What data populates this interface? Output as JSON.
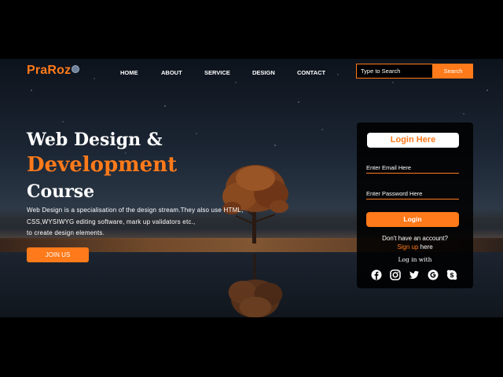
{
  "brand": {
    "name": "PraRoz"
  },
  "nav": {
    "items": [
      "HOME",
      "ABOUT",
      "SERVICE",
      "DESIGN",
      "CONTACT"
    ]
  },
  "search": {
    "placeholder": "Type to Search",
    "button": "Search"
  },
  "hero": {
    "line1": "Web Design &",
    "line2": "Development",
    "line3": "Course",
    "description": [
      "Web Design is a specialisation of the design stream.They also use HTML,",
      "CSS,WYSIWYG editing software, mark up validators etc.,",
      "to create design elements."
    ],
    "cta": "JOIN US"
  },
  "login": {
    "title": "Login Here",
    "email_placeholder": "Enter Email Here",
    "password_placeholder": "Enter Password Here",
    "button": "Login",
    "no_account": "Don't have an account?",
    "signup_link": "Sign up",
    "signup_suffix": " here",
    "login_with": "Log in with",
    "socials": [
      "facebook-icon",
      "instagram-icon",
      "twitter-icon",
      "google-icon",
      "skype-icon"
    ]
  },
  "colors": {
    "accent": "#ff7a1a",
    "background": "#000000",
    "text": "#ffffff"
  }
}
